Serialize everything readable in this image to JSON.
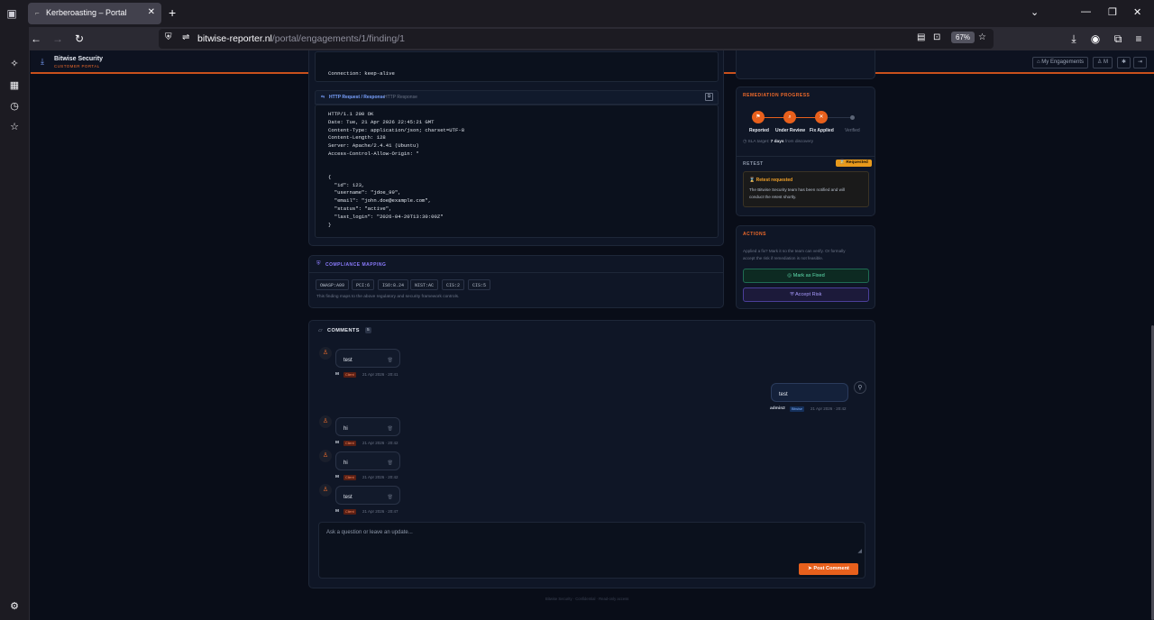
{
  "browser": {
    "tab_title": "Kerberoasting – Portal",
    "url_domain": "bitwise-reporter.nl",
    "url_path": "/portal/engagements/1/finding/1",
    "zoom": "67%"
  },
  "app": {
    "brand_name": "Bitwise Security",
    "brand_sub": "CUSTOMER PORTAL",
    "nav_my_engagements": "My Engagements",
    "nav_user": "M"
  },
  "request_tail": {
    "line1": "Connection: keep-alive"
  },
  "http_panel": {
    "title": "HTTP Request / Response",
    "subtitle": "HTTP Response",
    "lines": [
      "HTTP/1.1 200 OK",
      "Date: Tue, 21 Apr 2026 22:45:21 GMT",
      "Content-Type: application/json; charset=UTF-8",
      "Content-Length: 128",
      "Server: Apache/2.4.41 (Ubuntu)",
      "Access-Control-Allow-Origin: *",
      "",
      "{",
      "  \"id\": 123,",
      "  \"username\": \"jdoe_99\",",
      "  \"email\": \"john.doe@example.com\",",
      "  \"status\": \"active\",",
      "  \"last_login\": \"2026-04-20T13:30:00Z\"",
      "}"
    ]
  },
  "compliance": {
    "title": "COMPLIANCE MAPPING",
    "tags": [
      "OWASP:A09",
      "PCI:6",
      "ISO:8.24",
      "NIST:AC",
      "CIS:2",
      "CIS:5"
    ],
    "note": "This finding maps to the above regulatory and security framework controls."
  },
  "remediation": {
    "title": "REMEDIATION PROGRESS",
    "steps": [
      "Reported",
      "Under Review",
      "Fix Applied",
      "Verified"
    ],
    "sla_prefix": "SLA target:",
    "sla_value": "7 days",
    "sla_suffix": "from discovery"
  },
  "retest": {
    "title": "RETEST",
    "badge": "Requested",
    "box_title": "Retest requested",
    "box_text_1": "The Bitwise Security team has been notified and will",
    "box_text_2": "conduct the retest shortly."
  },
  "actions": {
    "title": "ACTIONS",
    "text_1": "Applied a fix? Mark it so the team can verify. Or formally",
    "text_2": "accept the risk if remediation is not feasible.",
    "mark_fixed": "Mark as Fixed",
    "accept_risk": "Accept Risk"
  },
  "comments": {
    "title": "COMMENTS",
    "count": "5",
    "items": [
      {
        "text": "test",
        "author": "M",
        "role": "Client",
        "time": "21 Apr 2026 · 20:41"
      },
      {
        "text": "test",
        "author": "admin2",
        "role": "Bitwise",
        "time": "21 Apr 2026 · 20:42"
      },
      {
        "text": "hi",
        "author": "M",
        "role": "Client",
        "time": "21 Apr 2026 · 20:42"
      },
      {
        "text": "hi",
        "author": "M",
        "role": "Client",
        "time": "21 Apr 2026 · 20:42"
      },
      {
        "text": "test",
        "author": "M",
        "role": "Client",
        "time": "21 Apr 2026 · 20:47"
      }
    ],
    "placeholder": "Ask a question or leave an update...",
    "post_button": "Post Comment"
  },
  "footer": "Bitwise Security · Confidential · Read-only access",
  "icons": [
    "tab-list-icon",
    "sidebar-toggle-icon",
    "back-icon",
    "forward-icon",
    "reload-icon",
    "shield-icon",
    "reader-icon",
    "save-icon",
    "bookmark-star-icon",
    "download-icon",
    "account-icon",
    "extensions-icon",
    "menu-icon",
    "ai-icon",
    "history-icon",
    "bookmarks-icon",
    "settings-icon"
  ]
}
